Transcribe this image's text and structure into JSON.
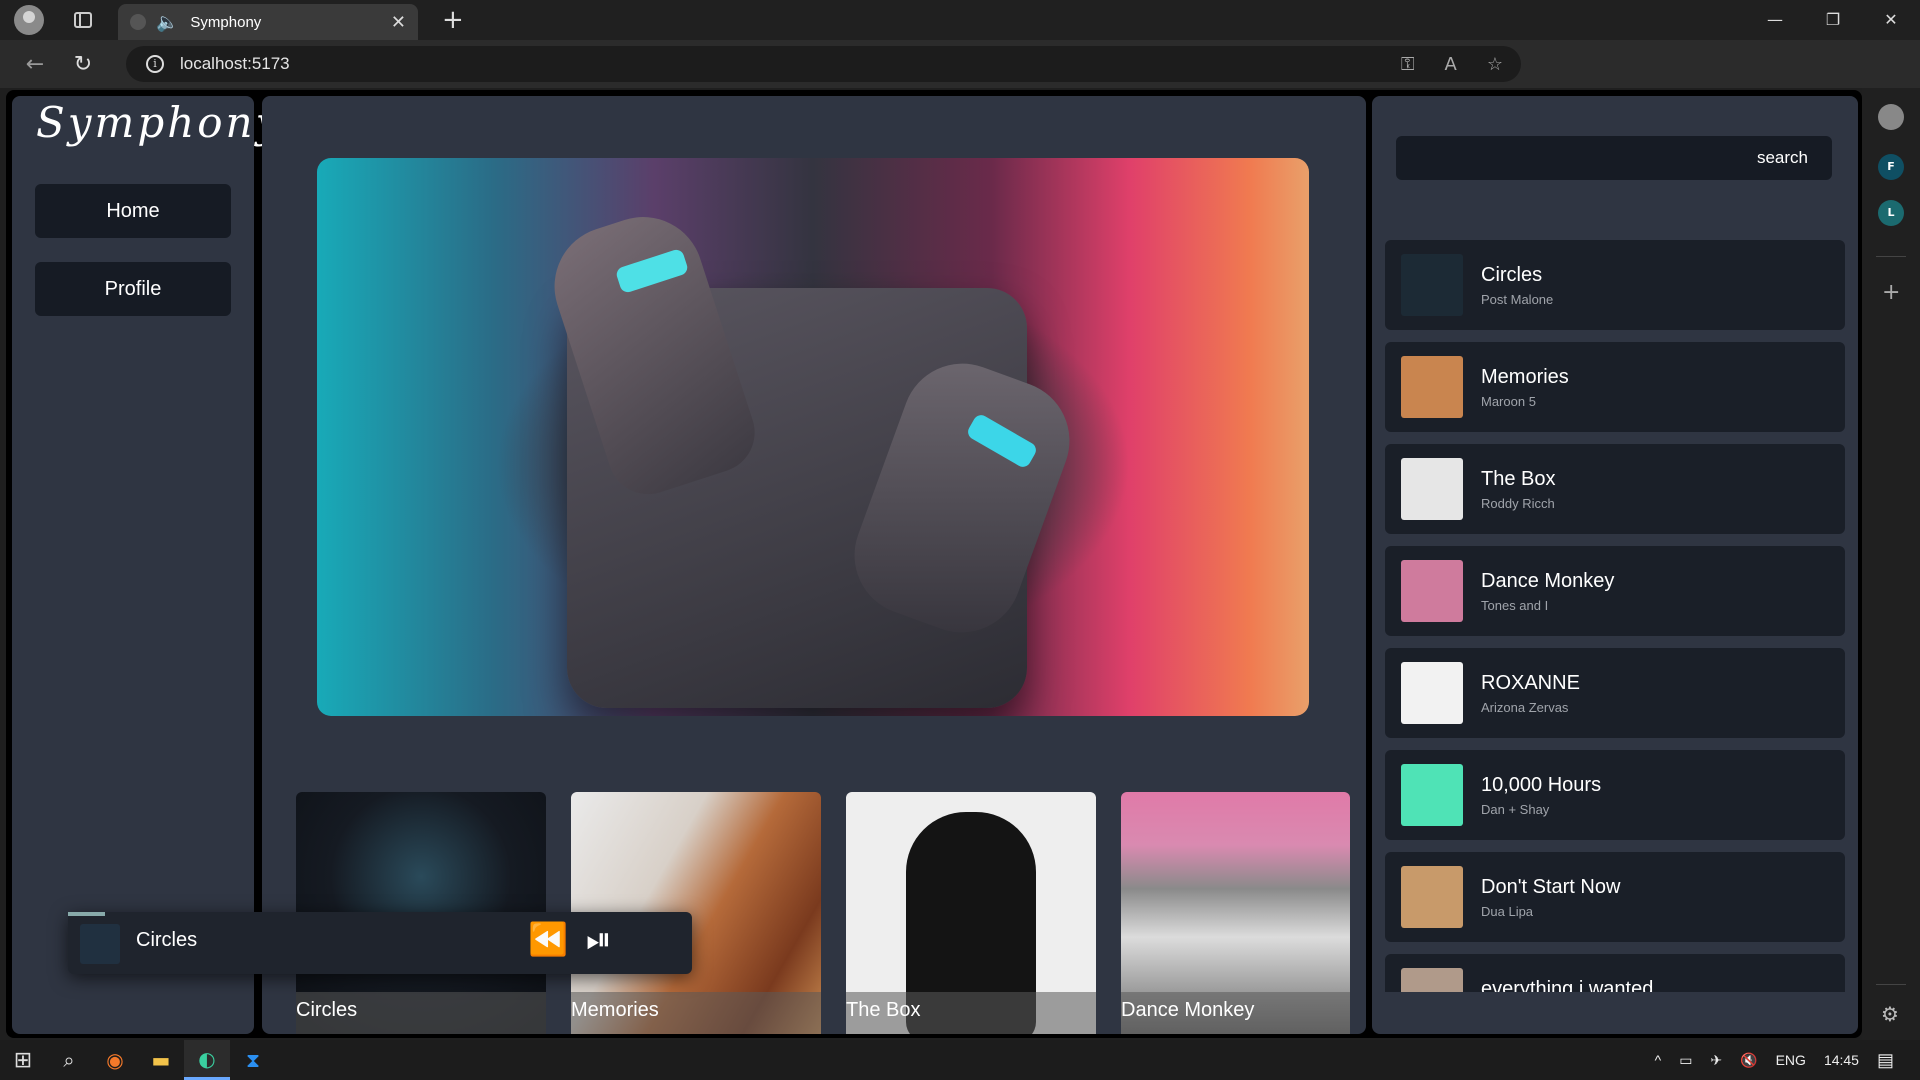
{
  "browser": {
    "tab_title": "Symphony",
    "url": "localhost:5173",
    "new_tab_glyph": "+",
    "tab_close_glyph": "✕"
  },
  "window_controls": {
    "minimize": "—",
    "maximize": "❐",
    "close": "✕"
  },
  "app": {
    "logo": "Symphony",
    "nav": [
      {
        "label": "Home"
      },
      {
        "label": "Profile"
      }
    ],
    "search": {
      "button_label": "search",
      "value": ""
    }
  },
  "featured_cards": [
    {
      "title": "Circles",
      "color": "#151a22"
    },
    {
      "title": "Memories",
      "color": "#b56a3a"
    },
    {
      "title": "The Box",
      "color": "#e8e8e8"
    },
    {
      "title": "Dance Monkey",
      "color": "#d87aa0"
    }
  ],
  "player": {
    "now_playing": "Circles",
    "progress": 0.06
  },
  "songs": [
    {
      "title": "Circles",
      "artist": "Post Malone",
      "art_color": "#1c2a35"
    },
    {
      "title": "Memories",
      "artist": "Maroon 5",
      "art_color": "#c9854f"
    },
    {
      "title": "The Box",
      "artist": "Roddy Ricch",
      "art_color": "#e6e6e6"
    },
    {
      "title": "Dance Monkey",
      "artist": "Tones and I",
      "art_color": "#cf7b9d"
    },
    {
      "title": "ROXANNE",
      "artist": "Arizona Zervas",
      "art_color": "#f2f2f2"
    },
    {
      "title": "10,000 Hours",
      "artist": "Dan + Shay",
      "art_color": "#4fe3b6"
    },
    {
      "title": "Don't Start Now",
      "artist": "Dua Lipa",
      "art_color": "#c89a6a"
    },
    {
      "title": "everything i wanted",
      "artist": "",
      "art_color": "#b09a8a"
    }
  ],
  "edge_sidebar": {
    "items": [
      "F",
      "L"
    ]
  },
  "taskbar": {
    "language": "ENG",
    "time": "14:45"
  },
  "colors": {
    "panel": "#2f3542",
    "button_bg": "#161b24",
    "song_bg": "#1a1f28"
  }
}
